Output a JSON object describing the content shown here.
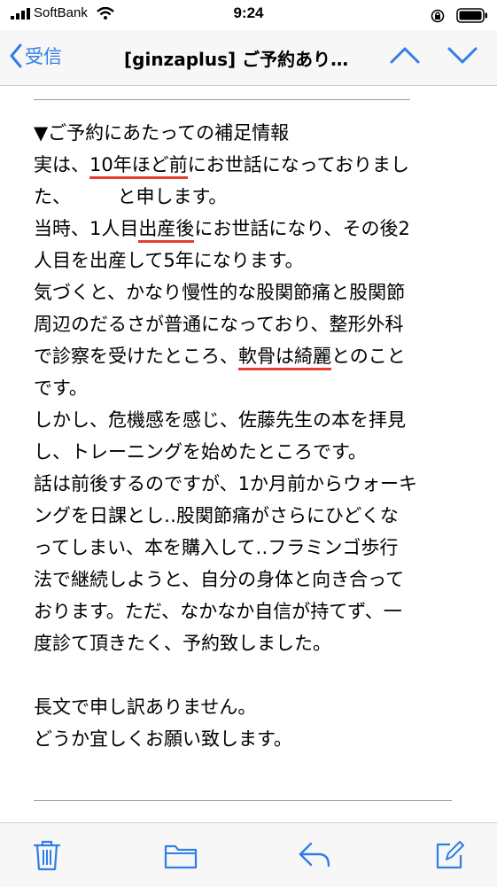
{
  "status_bar": {
    "carrier": "SoftBank",
    "time": "9:24"
  },
  "nav": {
    "back_label": "受信",
    "title": "[ginzaplus] ご予約あり…"
  },
  "message": {
    "section_heading": "▼ご予約にあたっての補足情報",
    "lines": [
      "実は、",
      "10年ほど前",
      "にお世話になっておりまし",
      "た、　　　と申します。",
      "当時、1人目",
      "出産後",
      "にお世話になり、その後2",
      "人目を出産して5年になります。",
      "気づくと、かなり慢性的な股関節痛と股関節",
      "周辺のだるさが普通になっており、整形外科",
      "で診察を受けたところ、",
      "軟骨は綺麗",
      "とのこと",
      "です。",
      "しかし、危機感を感じ、佐藤先生の本を拝見",
      "し、トレーニングを始めたところです。",
      "話は前後するのですが、1か月前からウォーキ",
      "ングを日課とし‥股関節痛がさらにひどくな",
      "ってしまい、本を購入して‥フラミンゴ歩行",
      "法で継続しようと、自分の身体と向き合って",
      "おります。ただ、なかなか自信が持てず、一",
      "度診て頂きたく、予約致しました。"
    ],
    "closing": [
      "長文で申し訳ありません。",
      "どうか宜しくお願い致します。"
    ]
  },
  "colors": {
    "accent": "#2f7ee8",
    "underline": "#e53d2f"
  },
  "toolbar": {
    "icons": [
      "trash-icon",
      "folder-icon",
      "reply-icon",
      "compose-icon"
    ]
  }
}
